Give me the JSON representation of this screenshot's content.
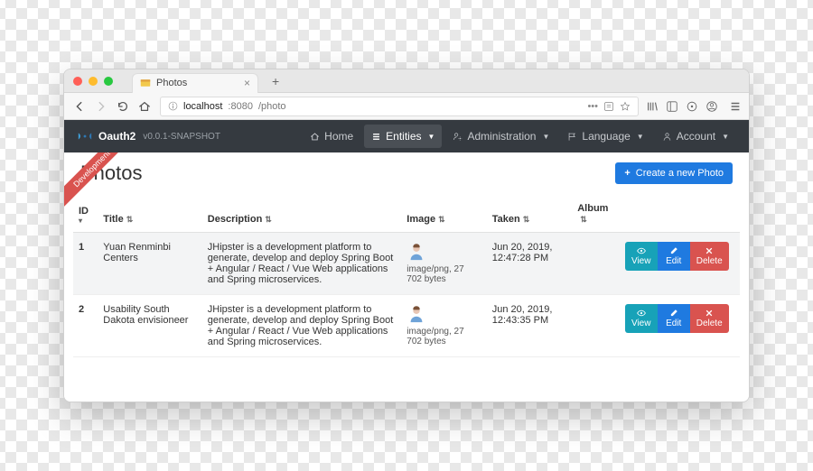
{
  "browser": {
    "tab_title": "Photos",
    "url_host": "localhost",
    "url_port": ":8080",
    "url_path": "/photo"
  },
  "ribbon": "Development",
  "navbar": {
    "brand": "Oauth2",
    "version": "v0.0.1-SNAPSHOT",
    "items": {
      "home": "Home",
      "entities": "Entities",
      "admin": "Administration",
      "lang": "Language",
      "account": "Account"
    }
  },
  "page": {
    "title": "Photos",
    "create_btn": "Create a new Photo"
  },
  "table": {
    "headers": {
      "id": "ID",
      "title": "Title",
      "description": "Description",
      "image": "Image",
      "taken": "Taken",
      "album": "Album"
    },
    "rows": [
      {
        "id": "1",
        "title": "Yuan Renminbi Centers",
        "description": "JHipster is a development platform to generate, develop and deploy Spring Boot + Angular / React / Vue Web applications and Spring microservices.",
        "image_meta": "image/png, 27 702 bytes",
        "taken": "Jun 20, 2019, 12:47:28 PM"
      },
      {
        "id": "2",
        "title": "Usability South Dakota envisioneer",
        "description": "JHipster is a development platform to generate, develop and deploy Spring Boot + Angular / React / Vue Web applications and Spring microservices.",
        "image_meta": "image/png, 27 702 bytes",
        "taken": "Jun 20, 2019, 12:43:35 PM"
      }
    ],
    "actions": {
      "view": "View",
      "edit": "Edit",
      "delete": "Delete"
    }
  }
}
